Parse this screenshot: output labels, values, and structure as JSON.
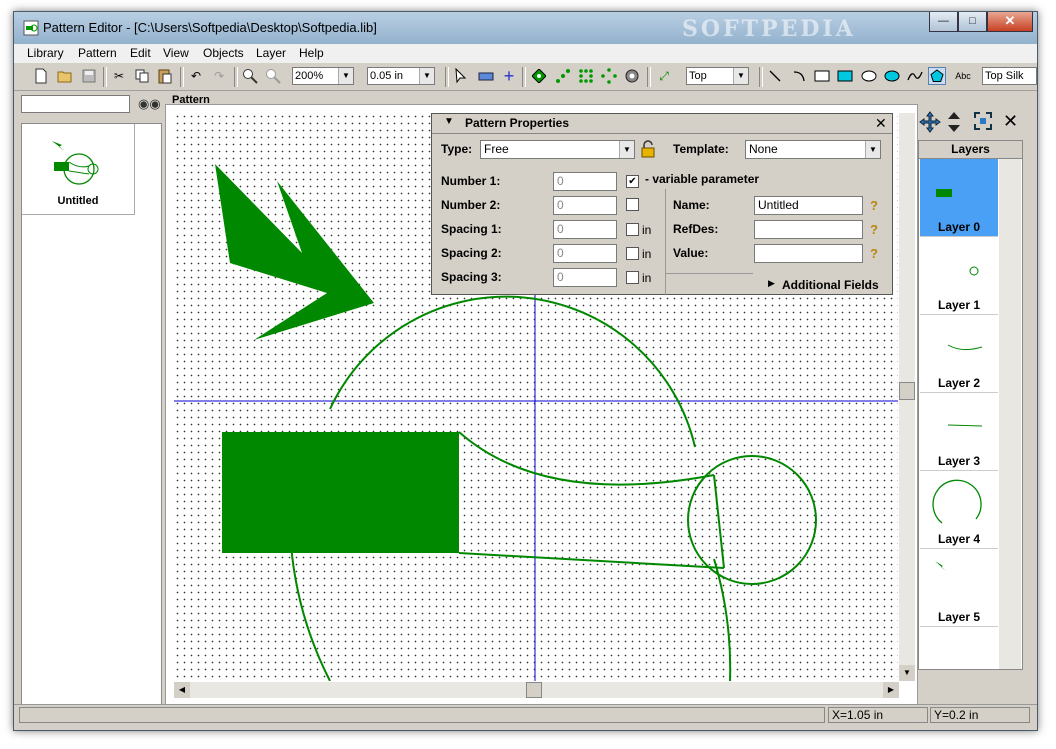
{
  "window": {
    "title": "Pattern Editor - [C:\\Users\\Softpedia\\Desktop\\Softpedia.lib]",
    "watermark": "SOFTPEDIA"
  },
  "menu": [
    "Library",
    "Pattern",
    "Edit",
    "View",
    "Objects",
    "Layer",
    "Help"
  ],
  "toolbar": {
    "zoom": "200%",
    "grid": "0.05 in",
    "side": "Top",
    "layer": "Top Silk",
    "text_tool": "Abc"
  },
  "library": {
    "search_value": "",
    "items": [
      {
        "label": "Untitled"
      }
    ]
  },
  "pattern_area": {
    "label": "Pattern"
  },
  "props": {
    "title": "Pattern Properties",
    "type_label": "Type:",
    "type_value": "Free",
    "template_label": "Template:",
    "template_value": "None",
    "number1_label": "Number 1:",
    "number1_value": "0",
    "number2_label": "Number 2:",
    "number2_value": "0",
    "spacing1_label": "Spacing 1:",
    "spacing1_value": "0",
    "spacing2_label": "Spacing 2:",
    "spacing2_value": "0",
    "spacing3_label": "Spacing 3:",
    "spacing3_value": "0",
    "variable_label": "- variable parameter",
    "in_label": "in",
    "name_label": "Name:",
    "name_value": "Untitled",
    "refdes_label": "RefDes:",
    "refdes_value": "",
    "value_label": "Value:",
    "value_value": "",
    "additional": "Additional Fields"
  },
  "layers": {
    "title": "Layers",
    "items": [
      {
        "label": "Layer 0",
        "selected": true
      },
      {
        "label": "Layer 1"
      },
      {
        "label": "Layer 2"
      },
      {
        "label": "Layer 3"
      },
      {
        "label": "Layer 4"
      },
      {
        "label": "Layer 5"
      }
    ]
  },
  "status": {
    "x": "X=1.05 in",
    "y": "Y=0.2 in"
  },
  "colors": {
    "shape": "#008800",
    "crosshair": "#0000cc",
    "selected_layer": "#4aa0f5"
  }
}
